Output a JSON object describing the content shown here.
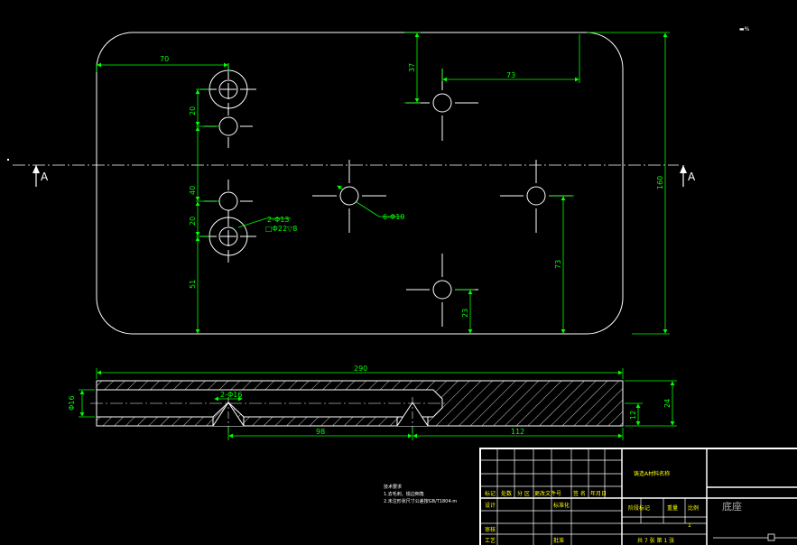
{
  "top_view": {
    "dims": {
      "d70": "70",
      "d37": "37",
      "d73_top": "73",
      "d20_a": "20",
      "d40": "40",
      "d20_b": "20",
      "d51": "51",
      "d160": "160",
      "d73_right": "73",
      "d23": "23"
    },
    "callouts": {
      "counterbore_1": "2-Φ13",
      "counterbore_2": "□Φ22▽8",
      "holes": "6-Φ10"
    },
    "section_mark": "A",
    "corner_mark": "▬%"
  },
  "front_view": {
    "dims": {
      "d290": "290",
      "d2phi16": "2-Φ16",
      "dphi16": "Φ16",
      "d98": "98",
      "d112": "112",
      "d12": "12",
      "d24": "24"
    }
  },
  "notes": {
    "heading": "技术要求",
    "line1": "1.去毛刺、锐边倒角",
    "line2": "2.未注形状尺寸公差按GB/T1804-m"
  },
  "title_block": {
    "material": "铸造A材料名称",
    "part_name": "底座",
    "row_labels": {
      "mark": "标记",
      "count": "处数",
      "zone": "分 区",
      "change_doc": "更改文件号",
      "sign": "签 名",
      "date": "年月日",
      "design": "设计",
      "standardize": "标准化",
      "stage_mark": "阶段标记",
      "weight": "重量",
      "scale": "比例",
      "review": "审核",
      "process": "工艺",
      "approve": "批准"
    },
    "sheet_text": "共 7 张 第 1 张",
    "scale_value": "1"
  }
}
